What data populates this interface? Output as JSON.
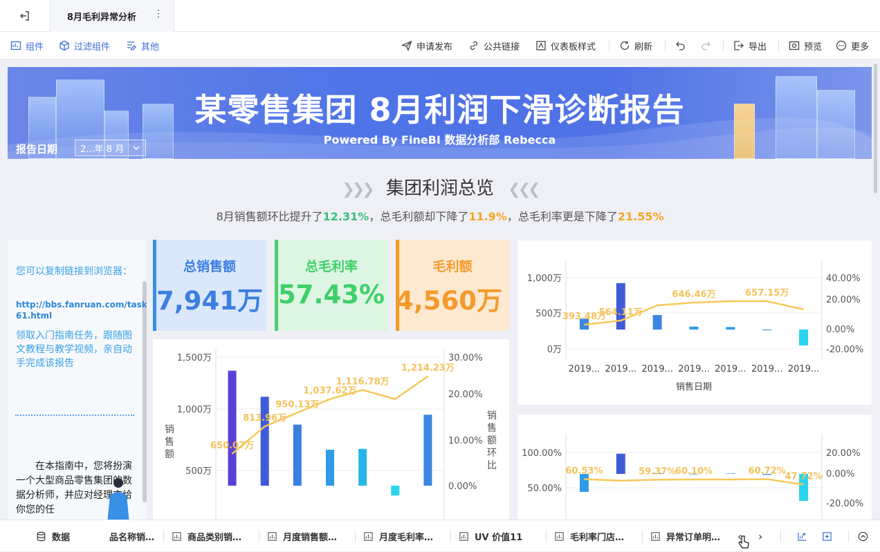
{
  "header": {
    "tab_title": "8月毛利异常分析"
  },
  "toolbar": {
    "left": [
      {
        "label": "组件",
        "icon": "add-chart-icon"
      },
      {
        "label": "过滤组件",
        "icon": "filter-cube-icon"
      },
      {
        "label": "其他",
        "icon": "edit-list-icon"
      }
    ],
    "right": [
      {
        "label": "申请发布",
        "icon": "send-icon"
      },
      {
        "label": "公共链接",
        "icon": "link-icon"
      },
      {
        "label": "仪表板样式",
        "icon": "style-icon"
      },
      {
        "label": "刷新",
        "icon": "refresh-icon"
      },
      {
        "label": "导出",
        "icon": "export-icon"
      },
      {
        "label": "预览",
        "icon": "preview-icon"
      },
      {
        "label": "更多",
        "icon": "more-icon"
      }
    ]
  },
  "banner": {
    "title": "某零售集团 8月利润下滑诊断报告",
    "subtitle": "Powered By FineBI 数据分析部 Rebecca",
    "date_label": "报告日期",
    "date_value": "2...年 8  月"
  },
  "overview": {
    "title": "集团利润总览",
    "summary_pre": "8月销售额环比提升了",
    "summary_v1": "12.31%",
    "summary_mid": "，总毛利额却下降了",
    "summary_v2": "11.9%",
    "summary_mid2": "，总毛利率更是下降了",
    "summary_v3": "21.55%"
  },
  "guide": {
    "line1": "您可以复制链接到浏览器：",
    "link": "http://bbs.fanruan.com/task-61.html",
    "line2": "领取入门指南任务，跟随图文教程与教学视频，亲自动手完成该报告",
    "story": "在本指南中，您将扮演一个大型商品零售集团的数据分析师，并应对经理交给你您的任"
  },
  "kpis": [
    {
      "label": "总销售额",
      "value": "7,941万",
      "color": "#3d7fe0",
      "bg": "#dbe8fb",
      "bar": "#3d8ee8"
    },
    {
      "label": "总毛利率",
      "value": "57.43%",
      "color": "#3fcf6a",
      "bg": "#ddf6e3",
      "bar": "#4cd06d"
    },
    {
      "label": "毛利额",
      "value": "4,560万",
      "color": "#f39a2c",
      "bg": "#fde9cf",
      "bar": "#f59a23"
    }
  ],
  "chart_data": [
    {
      "type": "bar",
      "title": "",
      "ylabel": "销售额",
      "y2label": "销售额环比",
      "yticks": [
        "1,500万",
        "1,000万",
        "500万"
      ],
      "y2ticks": [
        "30.00%",
        "20.00%",
        "10.00%",
        "0.00%"
      ],
      "ylim": [
        0,
        1500
      ],
      "y2lim": [
        -8,
        30
      ],
      "bars": [
        1280,
        990,
        680,
        400,
        410,
        -110,
        790
      ],
      "line_labels": [
        "650.07万",
        "813.96万",
        "950.13万",
        "1,037.62万",
        "1,116.78万",
        "1,214.23万"
      ],
      "line": [
        7,
        13,
        16,
        19,
        21,
        19,
        24
      ],
      "colors": [
        "#5b3fd6",
        "#3f5bd8",
        "#3b7fe0",
        "#2f9be6",
        "#28b6ea",
        "#2ad4ee",
        "#3b86e0"
      ]
    },
    {
      "type": "bar",
      "title": "",
      "xlabel": "销售日期",
      "yticks": [
        "1,000万",
        "500万",
        "0万"
      ],
      "y2ticks": [
        "40.00%",
        "20.00%",
        "0.00%",
        "-20.00%"
      ],
      "categories": [
        "2019...",
        "2019...",
        "2019...",
        "2019...",
        "2019...",
        "2019...",
        "2019..."
      ],
      "bars": [
        150,
        640,
        200,
        40,
        35,
        -10,
        -220
      ],
      "line_labels": [
        "393.48万",
        "564.11万",
        "646.46万",
        "657.15万"
      ],
      "line": [
        3,
        6,
        17,
        19,
        20,
        20,
        14
      ],
      "colors": [
        "#3b86e0",
        "#3f5bd8",
        "#3b86e0",
        "#2f9be6",
        "#2f9be6",
        "#3b86e0",
        "#2ad4ee"
      ]
    },
    {
      "type": "bar",
      "title": "",
      "yticks": [
        "100.00%",
        "50.00%"
      ],
      "y2ticks": [
        "20.00%",
        "0.00%",
        "-20.00%"
      ],
      "bars": [
        -40,
        45,
        2,
        -1,
        1,
        -2,
        -60
      ],
      "line_labels": [
        "60.53%",
        "59.37%",
        "60.10%",
        "60.72%",
        "47.72%"
      ],
      "line": [
        60.53,
        57,
        59.37,
        60.1,
        60.0,
        60.72,
        47.72
      ],
      "colors": [
        "#2f9be6",
        "#3f5bd8",
        "#3b86e0",
        "#2f9be6",
        "#3b86e0",
        "#3b86e0",
        "#2ad4ee"
      ]
    }
  ],
  "bottom": {
    "data_label": "数据",
    "tabs": [
      "品名称销…",
      "商品类别销…",
      "月度销售额…",
      "月度毛利率…",
      "UV 价值11",
      "毛利率门店…",
      "异常订单明…"
    ]
  }
}
